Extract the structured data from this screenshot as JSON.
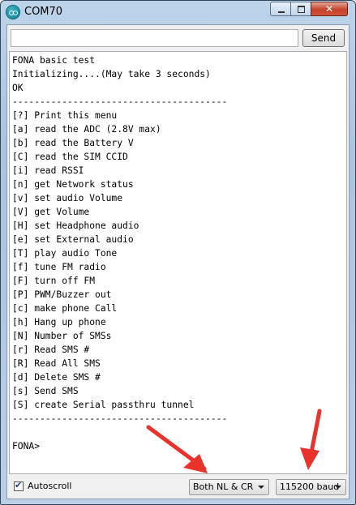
{
  "window": {
    "title": "COM70"
  },
  "send": {
    "input_value": "",
    "button_label": "Send"
  },
  "console": {
    "lines": [
      "FONA basic test",
      "Initializing....(May take 3 seconds)",
      "OK",
      "---------------------------------------",
      "[?] Print this menu",
      "[a] read the ADC (2.8V max)",
      "[b] read the Battery V",
      "[C] read the SIM CCID",
      "[i] read RSSI",
      "[n] get Network status",
      "[v] set audio Volume",
      "[V] get Volume",
      "[H] set Headphone audio",
      "[e] set External audio",
      "[T] play audio Tone",
      "[f] tune FM radio",
      "[F] turn off FM",
      "[P] PWM/Buzzer out",
      "[c] make phone Call",
      "[h] Hang up phone",
      "[N] Number of SMSs",
      "[r] Read SMS #",
      "[R] Read All SMS",
      "[d] Delete SMS #",
      "[s] Send SMS",
      "[S] create Serial passthru tunnel",
      "---------------------------------------",
      "",
      "FONA>"
    ]
  },
  "footer": {
    "autoscroll_label": "Autoscroll",
    "autoscroll_checked": true,
    "line_ending": "Both NL & CR",
    "baud_rate": "115200 baud"
  },
  "colors": {
    "annotation_arrow": "#e8322b",
    "window_frame": "#a9c4e0"
  }
}
